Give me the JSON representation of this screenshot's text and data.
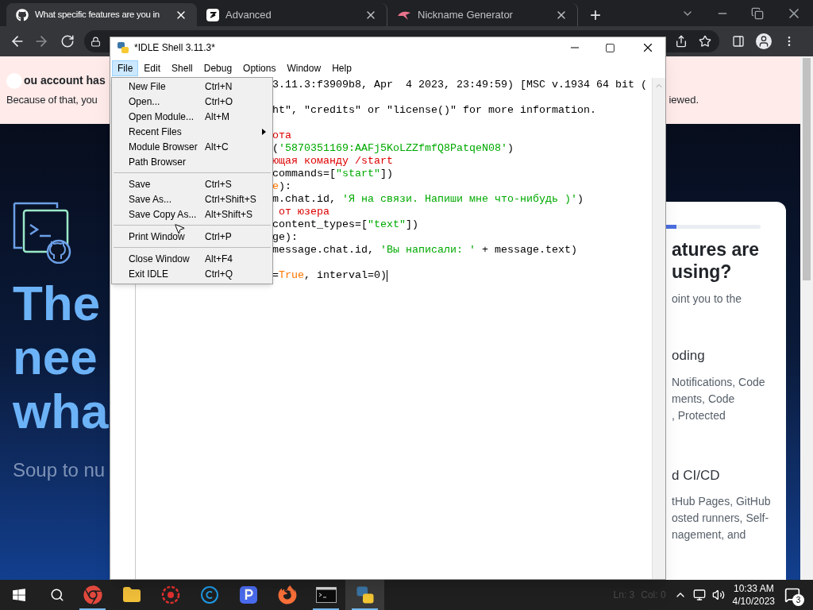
{
  "browser": {
    "tabs": [
      {
        "title": "What specific features are you in",
        "kind": "github",
        "selected": true
      },
      {
        "title": "Advanced",
        "kind": "three",
        "selected": false
      },
      {
        "title": "Nickname Generator",
        "kind": "bird",
        "selected": false
      }
    ],
    "new_tab": "+",
    "banner": {
      "line_1": "ou account has",
      "line_2": "Because of that, you",
      "line_2_end": "iewed."
    },
    "hero": {
      "heading_lines": [
        "The",
        "nee",
        "wha"
      ],
      "subtitle": "Soup to nu"
    },
    "card": {
      "heading_lines": [
        "atures are",
        "using?"
      ],
      "intro": "oint you to the",
      "sections": [
        {
          "title": "oding",
          "lines": [
            "Notifications, Code",
            "ments, Code",
            ", Protected"
          ]
        },
        {
          "title": "d CI/CD",
          "lines": [
            "tHub Pages, GitHub",
            "osted runners, Self-",
            "nagement, and"
          ]
        }
      ]
    }
  },
  "idle": {
    "title": "*IDLE Shell 3.11.3*",
    "menu": [
      {
        "label": "File",
        "selected": true
      },
      {
        "label": "Edit",
        "selected": false
      },
      {
        "label": "Shell",
        "selected": false
      },
      {
        "label": "Debug",
        "selected": false
      },
      {
        "label": "Options",
        "selected": false
      },
      {
        "label": "Window",
        "selected": false
      },
      {
        "label": "Help",
        "selected": false
      }
    ],
    "file_menu": [
      {
        "kind": "item",
        "label": "New File",
        "shortcut": "Ctrl+N"
      },
      {
        "kind": "item",
        "label": "Open...",
        "shortcut": "Ctrl+O"
      },
      {
        "kind": "item",
        "label": "Open Module...",
        "shortcut": "Alt+M"
      },
      {
        "kind": "submenu",
        "label": "Recent Files"
      },
      {
        "kind": "item",
        "label": "Module Browser",
        "shortcut": "Alt+C"
      },
      {
        "kind": "item",
        "label": "Path Browser"
      },
      {
        "kind": "separator"
      },
      {
        "kind": "item",
        "label": "Save",
        "shortcut": "Ctrl+S"
      },
      {
        "kind": "item",
        "label": "Save As...",
        "shortcut": "Ctrl+Shift+S"
      },
      {
        "kind": "item",
        "label": "Save Copy As...",
        "shortcut": "Alt+Shift+S"
      },
      {
        "kind": "separator"
      },
      {
        "kind": "item",
        "label": "Print Window",
        "shortcut": "Ctrl+P"
      },
      {
        "kind": "separator"
      },
      {
        "kind": "item",
        "label": "Close Window",
        "shortcut": "Alt+F4"
      },
      {
        "kind": "item",
        "label": "Exit IDLE",
        "shortcut": "Ctrl+Q"
      }
    ],
    "code_lines": [
      {
        "kind": "code",
        "segments": [
          {
            "text": "3.11.3:f3909b8, Apr  4 2023, 23:49:59) [MSC v.1934 64 bit (",
            "kind": "plain"
          }
        ]
      },
      {
        "kind": "blank"
      },
      {
        "kind": "code",
        "segments": [
          {
            "text": "ht\", \"credits\" or \"license()\" for more information.",
            "kind": "plain"
          }
        ]
      },
      {
        "kind": "blank"
      },
      {
        "kind": "code",
        "segments": [
          {
            "text": "ота",
            "kind": "comment"
          }
        ]
      },
      {
        "kind": "code",
        "segments": [
          {
            "text": "(",
            "kind": "plain"
          },
          {
            "text": "'5870351169:AAFj5KoLZZfmfQ8PatqeN08'",
            "kind": "string"
          },
          {
            "text": ")",
            "kind": "plain"
          }
        ]
      },
      {
        "kind": "code",
        "segments": [
          {
            "text": "ющая команду /start",
            "kind": "comment"
          }
        ]
      },
      {
        "kind": "code",
        "segments": [
          {
            "text": "commands=[",
            "kind": "plain"
          },
          {
            "text": "\"start\"",
            "kind": "string"
          },
          {
            "text": "])",
            "kind": "plain"
          }
        ]
      },
      {
        "kind": "code",
        "segments": [
          {
            "text": "e",
            "kind": "keyword"
          },
          {
            "text": "):",
            "kind": "plain"
          }
        ]
      },
      {
        "kind": "code",
        "segments": [
          {
            "text": "m.chat.id, ",
            "kind": "plain"
          },
          {
            "text": "'Я на связи. Напиши мне что-нибудь )'",
            "kind": "string"
          },
          {
            "text": ")",
            "kind": "plain"
          }
        ]
      },
      {
        "kind": "code",
        "segments": [
          {
            "text": " от юзера",
            "kind": "comment"
          }
        ]
      },
      {
        "kind": "code",
        "segments": [
          {
            "text": "content_types=[",
            "kind": "plain"
          },
          {
            "text": "\"text\"",
            "kind": "string"
          },
          {
            "text": "])",
            "kind": "plain"
          }
        ]
      },
      {
        "kind": "code",
        "segments": [
          {
            "text": "ge):",
            "kind": "plain"
          }
        ]
      },
      {
        "kind": "code",
        "segments": [
          {
            "text": "message.chat.id, ",
            "kind": "plain"
          },
          {
            "text": "'Вы написали: '",
            "kind": "string"
          },
          {
            "text": " + message.text)",
            "kind": "plain"
          }
        ]
      },
      {
        "kind": "blank"
      },
      {
        "kind": "code",
        "cursor": true,
        "segments": [
          {
            "text": "=",
            "kind": "plain"
          },
          {
            "text": "True",
            "kind": "keyword"
          },
          {
            "text": ", interval=0)",
            "kind": "plain"
          }
        ]
      }
    ]
  },
  "taskbar": {
    "status": [
      "Ln: 3",
      "Col: 0"
    ],
    "time": "10:33 AM",
    "date": "4/10/2023",
    "notifications": "3",
    "apps": [
      {
        "kind": "chrome",
        "running": true,
        "selected": false
      },
      {
        "kind": "folder",
        "running": false,
        "selected": false
      },
      {
        "kind": "gear",
        "running": false,
        "selected": false
      },
      {
        "kind": "c",
        "running": false,
        "selected": false
      },
      {
        "kind": "p",
        "running": false,
        "selected": false
      },
      {
        "kind": "firefox",
        "running": false,
        "selected": false
      },
      {
        "kind": "terminal",
        "running": true,
        "selected": false
      },
      {
        "kind": "python",
        "running": true,
        "selected": true
      }
    ]
  }
}
